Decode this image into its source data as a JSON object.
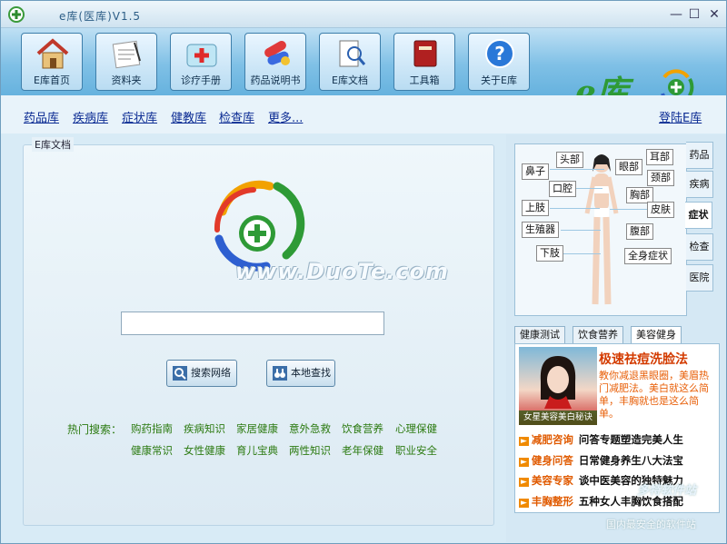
{
  "window": {
    "title": "e库(医库)V1.5",
    "minimize": "—",
    "maximize": "☐",
    "close": "✕"
  },
  "toolbar": {
    "items": [
      {
        "label": "E库首页",
        "icon": "home-icon"
      },
      {
        "label": "资料夹",
        "icon": "folder-icon"
      },
      {
        "label": "诊疗手册",
        "icon": "medkit-icon"
      },
      {
        "label": "药品说明书",
        "icon": "pills-icon"
      },
      {
        "label": "E库文档",
        "icon": "document-icon"
      },
      {
        "label": "工具箱",
        "icon": "book-icon"
      },
      {
        "label": "关于E库",
        "icon": "help-icon"
      }
    ],
    "brand_text": "e库"
  },
  "nav": {
    "links": [
      "药品库",
      "疾病库",
      "症状库",
      "健教库",
      "检查库",
      "更多..."
    ],
    "login": "登陆E库"
  },
  "doc": {
    "legend": "E库文档",
    "watermark": "www.DuoTe.com",
    "search_value": "",
    "btn_web": "搜索网络",
    "btn_local": "本地查找",
    "hot_label": "热门搜索：",
    "hot_row1": [
      "购药指南",
      "疾病知识",
      "家居健康",
      "意外急救",
      "饮食营养",
      "心理保健"
    ],
    "hot_row2": [
      "健康常识",
      "女性健康",
      "育儿宝典",
      "两性知识",
      "老年保健",
      "职业安全"
    ]
  },
  "body_map": {
    "labels": [
      "头部",
      "耳部",
      "鼻子",
      "眼部",
      "颈部",
      "口腔",
      "胸部",
      "上肢",
      "皮肤",
      "腹部",
      "生殖器",
      "下肢",
      "全身症状"
    ],
    "tabs": [
      "药品",
      "疾病",
      "症状",
      "检查",
      "医院"
    ],
    "active_tab": "症状"
  },
  "health": {
    "tabs": [
      "健康测试",
      "饮食营养",
      "美容健身"
    ],
    "active_tab": "美容健身",
    "pic_caption": "女星美容美白秘诀",
    "promo_title": "极速祛痘洗脸法",
    "promo_text": "教你减退黑眼圈，美眉热门减肥法。美白就这么简单，丰胸就也是这么简单。",
    "news": [
      {
        "cat": "减肥咨询",
        "text": "问答专题塑造完美人生"
      },
      {
        "cat": "健身问答",
        "text": "日常健身养生八大法宝"
      },
      {
        "cat": "美容专家",
        "text": "谈中医美容的独特魅力"
      },
      {
        "cat": "丰胸整形",
        "text": "五种女人丰胸饮食搭配"
      }
    ]
  },
  "corner": {
    "wm1": "多特软件站",
    "wm2": "国内最安全的软件站"
  },
  "colors": {
    "toolbar": "#7fc0e6",
    "nav_link": "#0b2b93",
    "hot": "#2b7a10",
    "promo": "#d33b00"
  }
}
